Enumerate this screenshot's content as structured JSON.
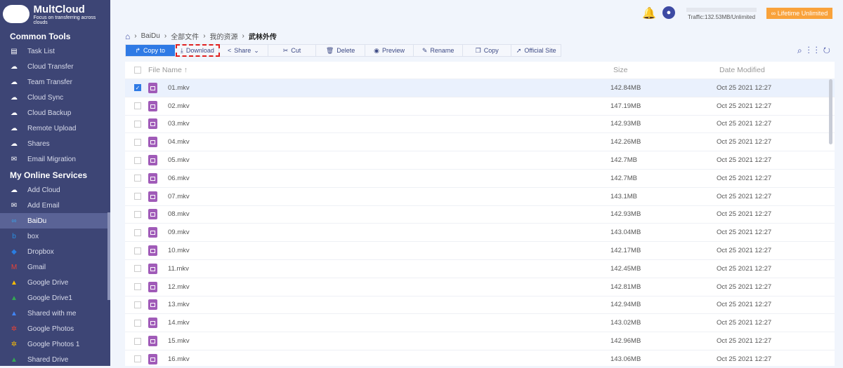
{
  "brand": {
    "name": "MultCloud",
    "tagline": "Focus on transferring across clouds"
  },
  "sidebar": {
    "common_title": "Common Tools",
    "common": [
      {
        "label": "Task List",
        "icon": "clipboard-icon"
      },
      {
        "label": "Cloud Transfer",
        "icon": "cloud-transfer-icon"
      },
      {
        "label": "Team Transfer",
        "icon": "team-transfer-icon"
      },
      {
        "label": "Cloud Sync",
        "icon": "cloud-sync-icon"
      },
      {
        "label": "Cloud Backup",
        "icon": "cloud-backup-icon"
      },
      {
        "label": "Remote Upload",
        "icon": "cloud-upload-icon"
      },
      {
        "label": "Shares",
        "icon": "share-icon"
      },
      {
        "label": "Email Migration",
        "icon": "email-icon"
      }
    ],
    "services_title": "My Online Services",
    "services": [
      {
        "label": "Add Cloud"
      },
      {
        "label": "Add Email"
      },
      {
        "label": "BaiDu"
      },
      {
        "label": "box"
      },
      {
        "label": "Dropbox"
      },
      {
        "label": "Gmail"
      },
      {
        "label": "Google Drive"
      },
      {
        "label": "Google Drive1"
      },
      {
        "label": "Shared with me"
      },
      {
        "label": "Google Photos"
      },
      {
        "label": "Google Photos 1"
      },
      {
        "label": "Shared Drive"
      }
    ]
  },
  "header": {
    "traffic": "Traffic:132.53MB/Unlimited",
    "lifetime": "Lifetime Unlimited"
  },
  "breadcrumb": [
    "BaiDu",
    "全部文件",
    "我的资源",
    "武林外传"
  ],
  "toolbar": {
    "copy_to": "Copy to",
    "download": "Download",
    "share": "Share",
    "cut": "Cut",
    "delete": "Delete",
    "preview": "Preview",
    "rename": "Rename",
    "copy": "Copy",
    "official_site": "Official Site"
  },
  "table": {
    "col_name": "File Name",
    "col_size": "Size",
    "col_date": "Date Modified",
    "rows": [
      {
        "name": "01.mkv",
        "size": "142.84MB",
        "date": "Oct 25 2021 12:27",
        "selected": true
      },
      {
        "name": "02.mkv",
        "size": "147.19MB",
        "date": "Oct 25 2021 12:27"
      },
      {
        "name": "03.mkv",
        "size": "142.93MB",
        "date": "Oct 25 2021 12:27"
      },
      {
        "name": "04.mkv",
        "size": "142.26MB",
        "date": "Oct 25 2021 12:27"
      },
      {
        "name": "05.mkv",
        "size": "142.7MB",
        "date": "Oct 25 2021 12:27"
      },
      {
        "name": "06.mkv",
        "size": "142.7MB",
        "date": "Oct 25 2021 12:27"
      },
      {
        "name": "07.mkv",
        "size": "143.1MB",
        "date": "Oct 25 2021 12:27"
      },
      {
        "name": "08.mkv",
        "size": "142.93MB",
        "date": "Oct 25 2021 12:27"
      },
      {
        "name": "09.mkv",
        "size": "143.04MB",
        "date": "Oct 25 2021 12:27"
      },
      {
        "name": "10.mkv",
        "size": "142.17MB",
        "date": "Oct 25 2021 12:27"
      },
      {
        "name": "11.mkv",
        "size": "142.45MB",
        "date": "Oct 25 2021 12:27"
      },
      {
        "name": "12.mkv",
        "size": "142.81MB",
        "date": "Oct 25 2021 12:27"
      },
      {
        "name": "13.mkv",
        "size": "142.94MB",
        "date": "Oct 25 2021 12:27"
      },
      {
        "name": "14.mkv",
        "size": "143.02MB",
        "date": "Oct 25 2021 12:27"
      },
      {
        "name": "15.mkv",
        "size": "142.96MB",
        "date": "Oct 25 2021 12:27"
      },
      {
        "name": "16.mkv",
        "size": "143.06MB",
        "date": "Oct 25 2021 12:27"
      }
    ]
  }
}
